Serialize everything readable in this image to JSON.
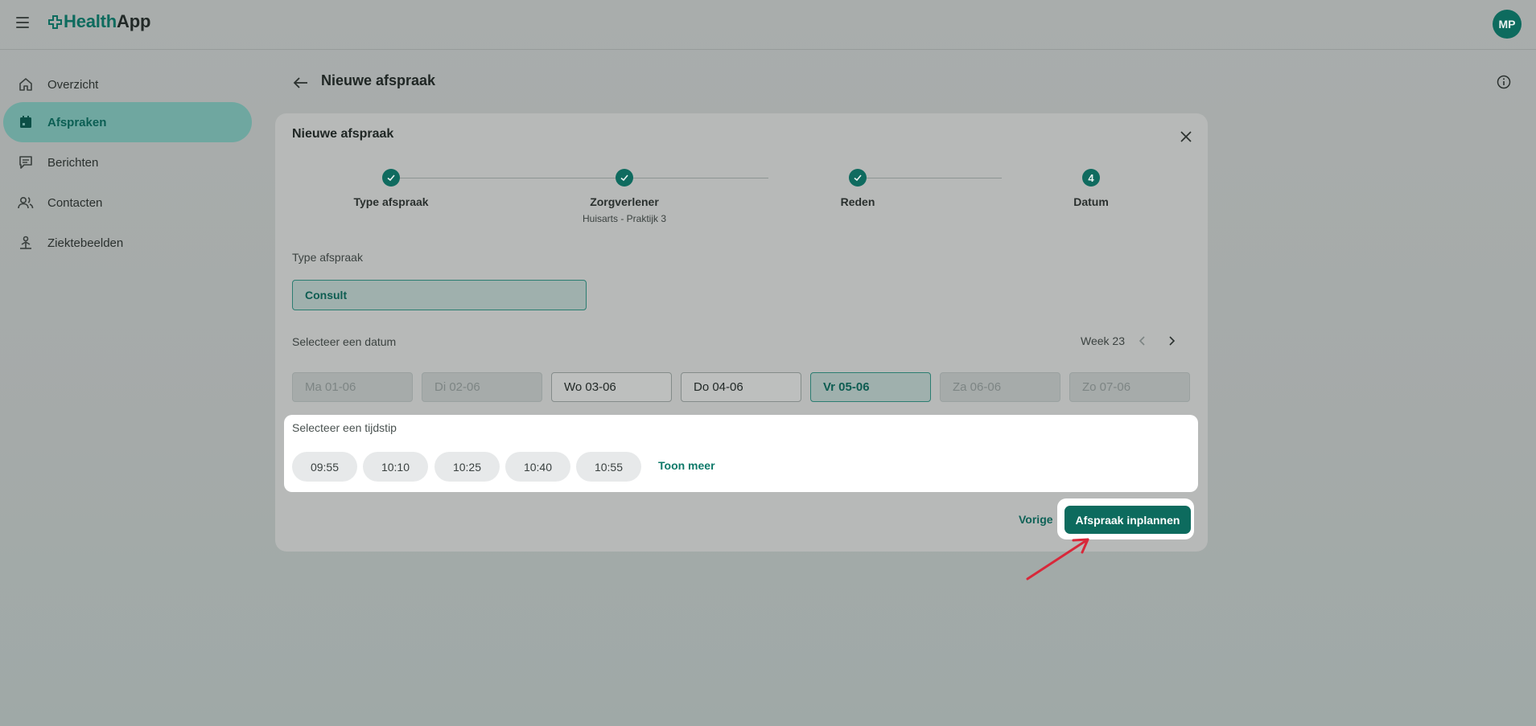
{
  "header": {
    "logo_health": "Health",
    "logo_app": "App",
    "avatar_initials": "MP"
  },
  "sidebar": {
    "items": [
      {
        "label": "Overzicht",
        "icon": "home-icon"
      },
      {
        "label": "Afspraken",
        "icon": "calendar-icon",
        "active": true
      },
      {
        "label": "Berichten",
        "icon": "message-icon"
      },
      {
        "label": "Contacten",
        "icon": "contacts-icon"
      },
      {
        "label": "Ziektebeelden",
        "icon": "condition-icon"
      }
    ]
  },
  "page": {
    "title": "Nieuwe afspraak"
  },
  "modal": {
    "title": "Nieuwe afspraak",
    "steps": [
      {
        "label": "Type afspraak",
        "sub": "",
        "state": "done"
      },
      {
        "label": "Zorgverlener",
        "sub": "Huisarts - Praktijk 3",
        "state": "done"
      },
      {
        "label": "Reden",
        "sub": "",
        "state": "done"
      },
      {
        "label": "Datum",
        "sub": "",
        "state": "current",
        "number": "4"
      }
    ],
    "type_label": "Type afspraak",
    "type_value": "Consult",
    "date_label": "Selecteer een datum",
    "week_label": "Week 23",
    "days": [
      {
        "label": "Ma 01-06",
        "state": "disabled"
      },
      {
        "label": "Di 02-06",
        "state": "disabled"
      },
      {
        "label": "Wo 03-06",
        "state": "enabled"
      },
      {
        "label": "Do 04-06",
        "state": "enabled"
      },
      {
        "label": "Vr 05-06",
        "state": "selected"
      },
      {
        "label": "Za 06-06",
        "state": "disabled"
      },
      {
        "label": "Zo 07-06",
        "state": "disabled"
      }
    ],
    "time_label": "Selecteer een tijdstip",
    "times": [
      "09:55",
      "10:10",
      "10:25",
      "10:40",
      "10:55"
    ],
    "show_more": "Toon meer",
    "back_label": "Vorige",
    "submit_label": "Afspraak inplannen"
  },
  "colors": {
    "primary": "#0d6b5e",
    "active_nav": "#6fa7a0",
    "annotation_arrow": "#d8283a"
  }
}
